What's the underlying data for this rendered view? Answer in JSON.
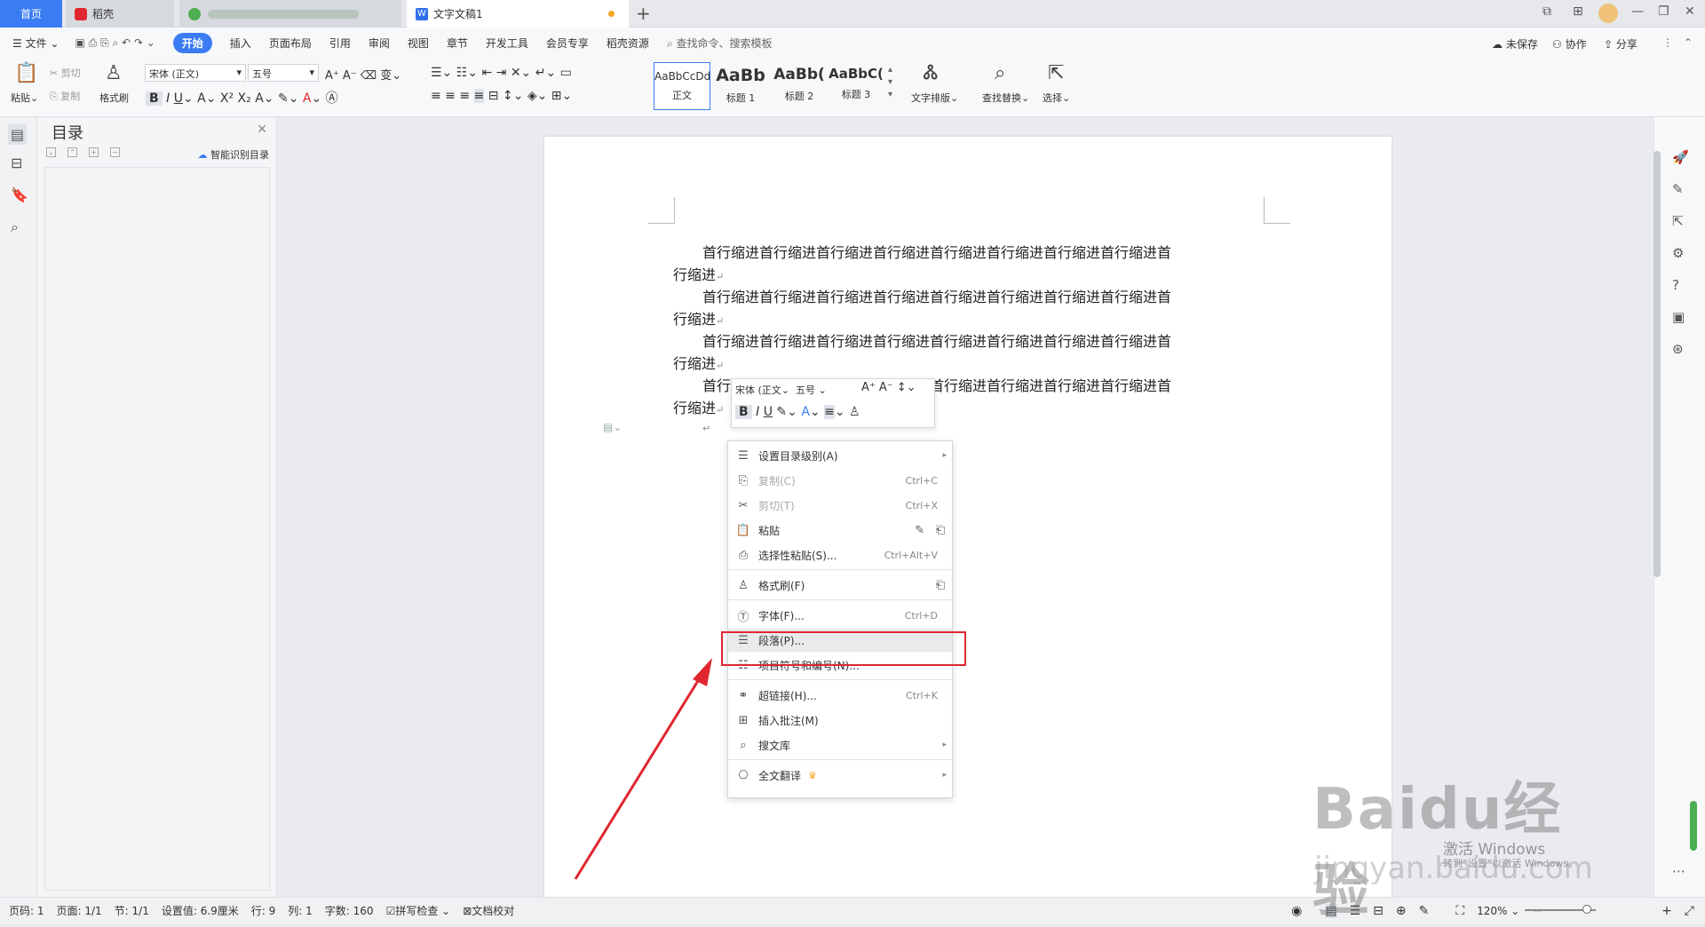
{
  "tabs": {
    "home": "首页",
    "daoke": "稻壳",
    "doc": "文字文稿1",
    "new": "+"
  },
  "menu": {
    "file": "文件",
    "start": "开始",
    "insert": "插入",
    "layout": "页面布局",
    "reference": "引用",
    "review": "审阅",
    "view": "视图",
    "chapter": "章节",
    "devtools": "开发工具",
    "vip": "会员专享",
    "daoke_res": "稻壳资源",
    "search": "查找命令、搜索模板",
    "unsaved": "未保存",
    "collab": "协作",
    "share": "分享"
  },
  "ribbon": {
    "paste": "粘贴",
    "cut": "剪切",
    "copy": "复制",
    "format_painter": "格式刷",
    "font_name": "宋体 (正文)",
    "font_size": "五号",
    "styles": [
      {
        "sample": "AaBbCcDd",
        "label": "正文"
      },
      {
        "sample": "AaBb",
        "label": "标题 1"
      },
      {
        "sample": "AaBb(",
        "label": "标题 2"
      },
      {
        "sample": "AaBbC(",
        "label": "标题 3"
      }
    ],
    "text_layout": "文字排版",
    "find_replace": "查找替换",
    "select": "选择"
  },
  "toc": {
    "title": "目录",
    "smart": "智能识别目录"
  },
  "doc": {
    "lines": [
      {
        "first": "首行缩进首行缩进首行缩进首行缩进首行缩进首行缩进首行缩进首行缩进首",
        "rest": "行缩进"
      },
      {
        "first": "首行缩进首行缩进首行缩进首行缩进首行缩进首行缩进首行缩进首行缩进首",
        "rest": "行缩进"
      },
      {
        "first": "首行缩进首行缩进首行缩进首行缩进首行缩进首行缩进首行缩进首行缩进首",
        "rest": "行缩进"
      },
      {
        "first": "首行缩进首行缩进首行缩进首行缩进首行缩进首行缩进首行缩进首行缩进首",
        "rest": "行缩进"
      }
    ]
  },
  "mini_toolbar": {
    "font": "宋体 (正文",
    "size": "五号"
  },
  "context_menu": {
    "toc_level": "设置目录级别(A)",
    "copy": "复制(C)",
    "copy_sc": "Ctrl+C",
    "cut": "剪切(T)",
    "cut_sc": "Ctrl+X",
    "paste": "粘贴",
    "paste_special": "选择性粘贴(S)...",
    "paste_special_sc": "Ctrl+Alt+V",
    "format_painter": "格式刷(F)",
    "font": "字体(F)...",
    "font_sc": "Ctrl+D",
    "paragraph": "段落(P)...",
    "bullets": "项目符号和编号(N)...",
    "hyperlink": "超链接(H)...",
    "hyperlink_sc": "Ctrl+K",
    "comment": "插入批注(M)",
    "search_lib": "搜文库",
    "translate": "全文翻译"
  },
  "status": {
    "page": "页码: 1",
    "pages": "页面: 1/1",
    "section": "节: 1/1",
    "setting": "设置值: 6.9厘米",
    "row": "行: 9",
    "col": "列: 1",
    "words": "字数: 160",
    "spell": "拼写检查",
    "proof": "文档校对",
    "zoom": "120%"
  },
  "watermark": {
    "brand": "Baidu经验",
    "activate": "激活 Windows",
    "activate_sub": "转到“设置”以激活 Windows。",
    "url": "jingyan.baidu.com"
  }
}
